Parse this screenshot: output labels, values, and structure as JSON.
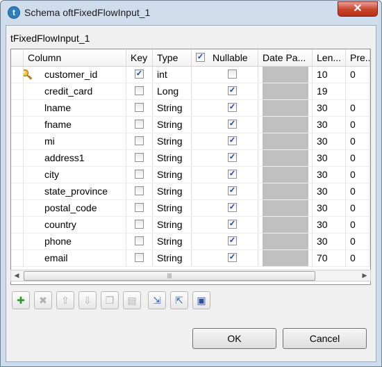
{
  "window": {
    "title": "Schema oftFixedFlowInput_1",
    "app_icon_letter": "t",
    "close_label": "✕"
  },
  "schema_name": "tFixedFlowInput_1",
  "columns_header": {
    "column": "Column",
    "key": "Key",
    "type": "Type",
    "nullable_check": "✓",
    "nullable": "Nullable",
    "date_pattern": "Date Pa...",
    "length": "Len...",
    "precision": "Pre..."
  },
  "rows": [
    {
      "column": "customer_id",
      "key": true,
      "type": "int",
      "nullable": false,
      "length": "10",
      "precision": "0",
      "key_icon": "key-icon"
    },
    {
      "column": "credit_card",
      "key": false,
      "type": "Long",
      "nullable": true,
      "length": "19",
      "precision": ""
    },
    {
      "column": "lname",
      "key": false,
      "type": "String",
      "nullable": true,
      "length": "30",
      "precision": "0"
    },
    {
      "column": "fname",
      "key": false,
      "type": "String",
      "nullable": true,
      "length": "30",
      "precision": "0"
    },
    {
      "column": "mi",
      "key": false,
      "type": "String",
      "nullable": true,
      "length": "30",
      "precision": "0"
    },
    {
      "column": "address1",
      "key": false,
      "type": "String",
      "nullable": true,
      "length": "30",
      "precision": "0"
    },
    {
      "column": "city",
      "key": false,
      "type": "String",
      "nullable": true,
      "length": "30",
      "precision": "0"
    },
    {
      "column": "state_province",
      "key": false,
      "type": "String",
      "nullable": true,
      "length": "30",
      "precision": "0"
    },
    {
      "column": "postal_code",
      "key": false,
      "type": "String",
      "nullable": true,
      "length": "30",
      "precision": "0"
    },
    {
      "column": "country",
      "key": false,
      "type": "String",
      "nullable": true,
      "length": "30",
      "precision": "0"
    },
    {
      "column": "phone",
      "key": false,
      "type": "String",
      "nullable": true,
      "length": "30",
      "precision": "0"
    },
    {
      "column": "email",
      "key": false,
      "type": "String",
      "nullable": true,
      "length": "70",
      "precision": "0"
    }
  ],
  "scrollbar": {
    "left_arrow": "◀",
    "right_arrow": "▶",
    "thumb_grip": "|||"
  },
  "toolbar": [
    {
      "name": "add-button",
      "icon": "plus-icon",
      "glyph": "✚",
      "enabled": true
    },
    {
      "name": "remove-button",
      "icon": "delete-icon",
      "glyph": "✖",
      "enabled": false
    },
    {
      "name": "move-up-button",
      "icon": "arrow-up-icon",
      "glyph": "⇧",
      "enabled": false
    },
    {
      "name": "move-down-button",
      "icon": "arrow-down-icon",
      "glyph": "⇩",
      "enabled": false
    },
    {
      "name": "copy-button",
      "icon": "copy-icon",
      "glyph": "❐",
      "enabled": false
    },
    {
      "name": "paste-button",
      "icon": "paste-icon",
      "glyph": "▤",
      "enabled": false
    },
    {
      "name": "import-button",
      "icon": "import-icon",
      "glyph": "⇲",
      "enabled": true
    },
    {
      "name": "export-button",
      "icon": "export-icon",
      "glyph": "⇱",
      "enabled": true
    },
    {
      "name": "save-button",
      "icon": "save-icon",
      "glyph": "▣",
      "enabled": true
    }
  ],
  "buttons": {
    "ok": "OK",
    "cancel": "Cancel"
  },
  "colors": {
    "titlebar": "#cfdceb",
    "close": "#c7432a",
    "date_pattern_cell": "#c0c0c0",
    "check": "#1b3f8c"
  }
}
